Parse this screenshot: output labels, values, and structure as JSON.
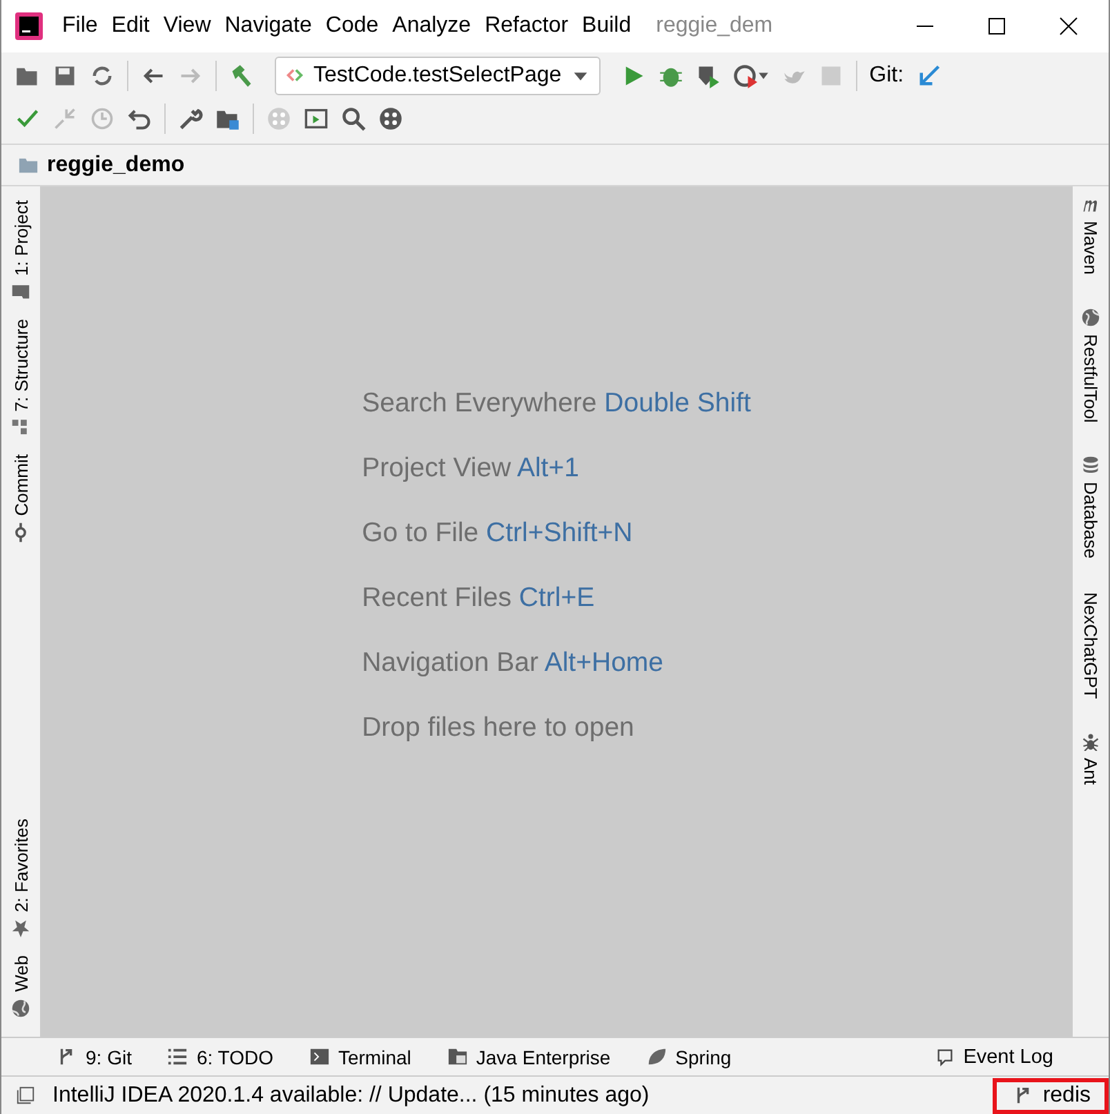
{
  "menu": [
    "File",
    "Edit",
    "View",
    "Navigate",
    "Code",
    "Analyze",
    "Refactor",
    "Build"
  ],
  "window": {
    "title": "reggie_dem"
  },
  "toolbar": {
    "run_config": "TestCode.testSelectPage",
    "git_label": "Git:"
  },
  "navigation": {
    "project": "reggie_demo"
  },
  "left_tools": [
    {
      "label": "1: Project",
      "kind": "folder"
    },
    {
      "label": "7: Structure",
      "kind": "structure"
    },
    {
      "label": "Commit",
      "kind": "commit"
    },
    {
      "label": "2: Favorites",
      "kind": "star"
    },
    {
      "label": "Web",
      "kind": "globe"
    }
  ],
  "right_tools": [
    {
      "label": "Maven",
      "kind": "maven"
    },
    {
      "label": "RestfulTool",
      "kind": "globe"
    },
    {
      "label": "Database",
      "kind": "database"
    },
    {
      "label": "NexChatGPT",
      "kind": "none"
    },
    {
      "label": "Ant",
      "kind": "ant"
    }
  ],
  "welcome": [
    {
      "text": "Search Everywhere",
      "shortcut": "Double Shift"
    },
    {
      "text": "Project View",
      "shortcut": "Alt+1"
    },
    {
      "text": "Go to File",
      "shortcut": "Ctrl+Shift+N"
    },
    {
      "text": "Recent Files",
      "shortcut": "Ctrl+E"
    },
    {
      "text": "Navigation Bar",
      "shortcut": "Alt+Home"
    },
    {
      "text": "Drop files here to open"
    }
  ],
  "bottom_tools": [
    {
      "label": "9: Git",
      "kind": "git"
    },
    {
      "label": "6: TODO",
      "kind": "list"
    },
    {
      "label": "Terminal",
      "kind": "terminal"
    },
    {
      "label": "Java Enterprise",
      "kind": "enterprise"
    },
    {
      "label": "Spring",
      "kind": "leaf"
    }
  ],
  "event_log": "Event Log",
  "status_bar": {
    "message": "IntelliJ IDEA 2020.1.4 available: // Update... (15 minutes ago)",
    "branch": "redis",
    "branch_highlighted": true
  }
}
